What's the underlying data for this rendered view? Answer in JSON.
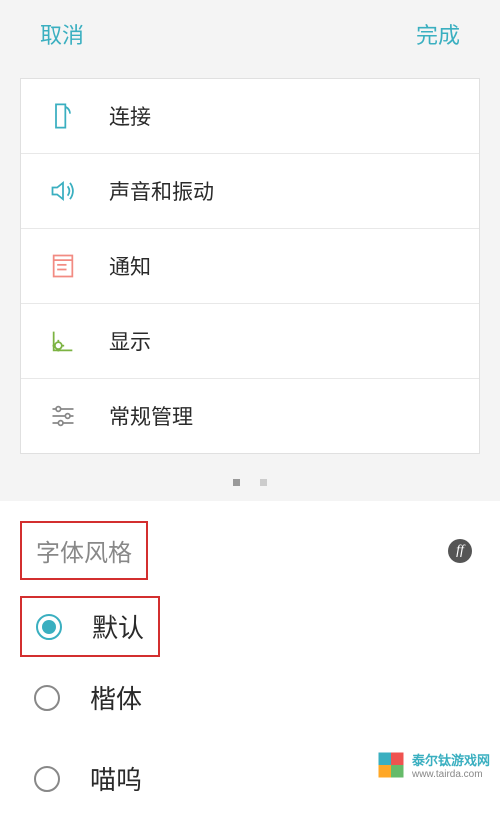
{
  "header": {
    "cancel": "取消",
    "done": "完成"
  },
  "settings": {
    "items": [
      {
        "label": "连接",
        "icon": "connect"
      },
      {
        "label": "声音和振动",
        "icon": "sound"
      },
      {
        "label": "通知",
        "icon": "notification"
      },
      {
        "label": "显示",
        "icon": "display"
      },
      {
        "label": "常规管理",
        "icon": "general"
      }
    ]
  },
  "font_section": {
    "title": "字体风格",
    "options": [
      {
        "label": "默认",
        "selected": true
      },
      {
        "label": "楷体",
        "selected": false
      },
      {
        "label": "喵呜",
        "selected": false
      }
    ]
  },
  "watermark": {
    "line1": "泰尔钛游戏网",
    "line2": "www.tairda.com"
  }
}
